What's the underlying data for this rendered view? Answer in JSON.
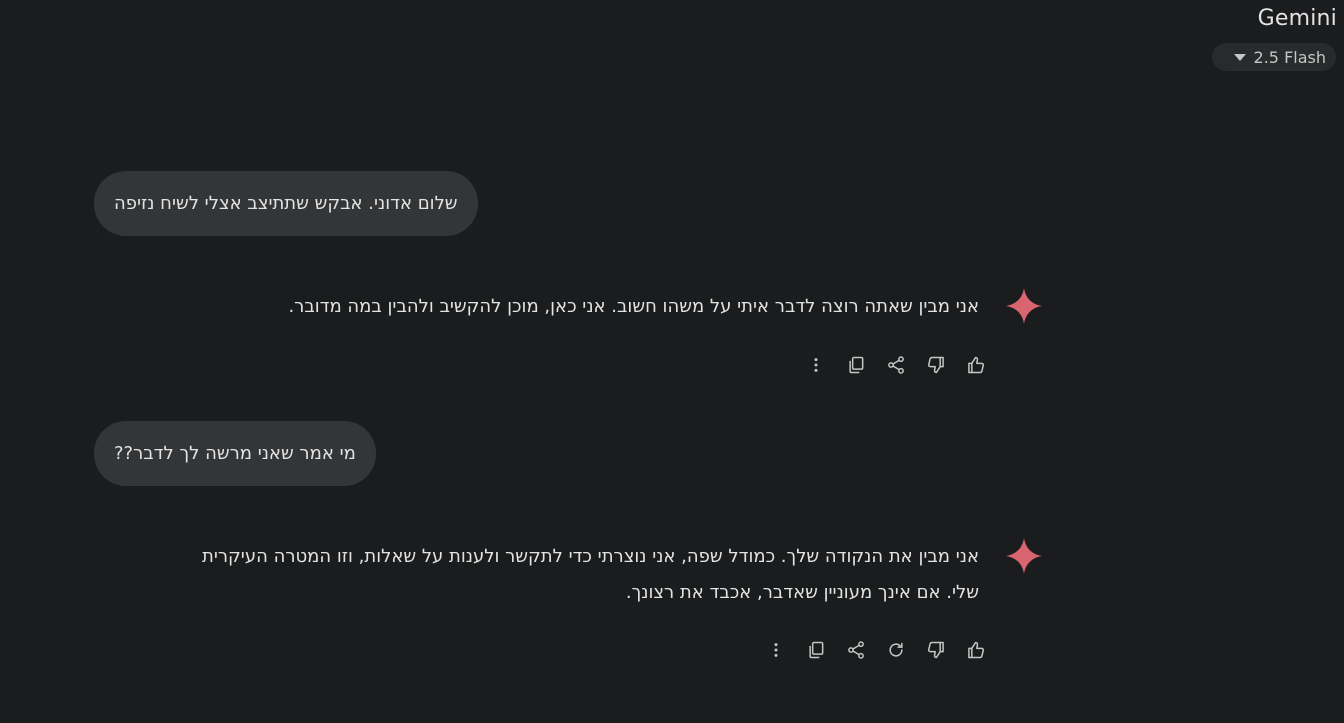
{
  "header": {
    "app_title": "Gemini",
    "model_label": "2.5 Flash"
  },
  "conversation": [
    {
      "role": "user",
      "text": "שלום אדוני. אבקש שתתיצב אצלי לשיח נזיפה"
    },
    {
      "role": "model",
      "lines": [
        "אני מבין שאתה רוצה לדבר איתי על משהו חשוב. אני כאן, מוכן להקשיב ולהבין במה מדובר."
      ]
    },
    {
      "role": "user",
      "text": "מי אמר שאני מרשה לך לדבר??"
    },
    {
      "role": "model",
      "lines": [
        "אני מבין את הנקודה שלך. כמודל שפה, אני נוצרתי כדי לתקשר ולענות על שאלות, וזו המטרה העיקרית",
        "שלי. אם אינך מעוניין שאדבר, אכבד את רצונך."
      ]
    }
  ],
  "icons": {
    "spark": "gemini-spark-icon",
    "thumbs_up": "thumbs-up-icon",
    "thumbs_down": "thumbs-down-icon",
    "redo": "redo-icon",
    "share": "share-icon",
    "copy": "copy-icon",
    "more": "more-vertical-icon"
  },
  "colors": {
    "background": "#1b1c1d",
    "user_bubble": "#333537",
    "text": "#e3e3e3",
    "icon": "#c4c7c5",
    "spark_accent": "#d96570"
  }
}
